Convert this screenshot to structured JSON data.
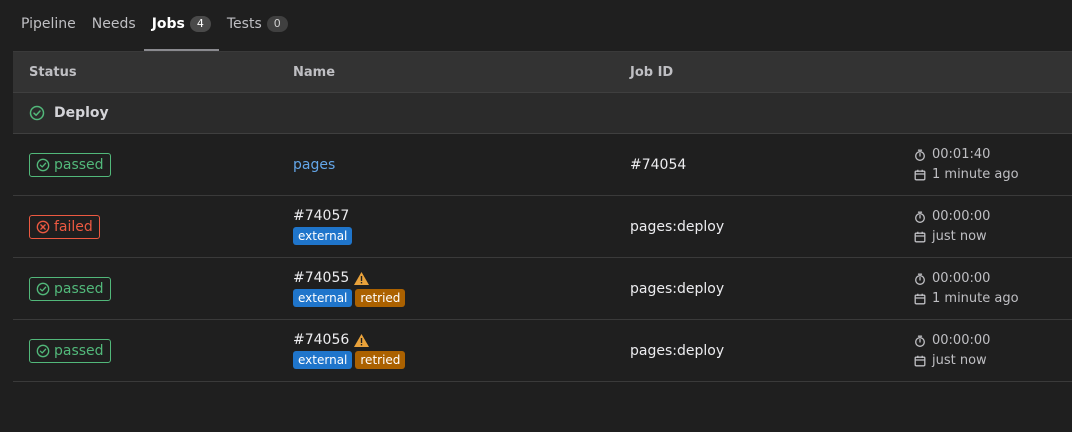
{
  "tabs": [
    {
      "label": "Pipeline"
    },
    {
      "label": "Needs"
    },
    {
      "label": "Jobs",
      "count": "4",
      "active": true
    },
    {
      "label": "Tests",
      "count": "0"
    }
  ],
  "table": {
    "headers": {
      "status": "Status",
      "name": "Name",
      "job_id": "Job ID"
    },
    "group": {
      "label": "Deploy",
      "icon": "status-success-icon"
    },
    "rows": [
      {
        "status": "passed",
        "name": "pages",
        "job_id": "#74054",
        "duration": "00:01:40",
        "finished": "1 minute ago"
      },
      {
        "status": "failed",
        "name": "#74057",
        "labels": [
          "external"
        ],
        "job_id": "pages:deploy",
        "duration": "00:00:00",
        "finished": "just now"
      },
      {
        "status": "passed",
        "name": "#74055",
        "warning": true,
        "labels": [
          "external",
          "retried"
        ],
        "job_id": "pages:deploy",
        "duration": "00:00:00",
        "finished": "1 minute ago"
      },
      {
        "status": "passed",
        "name": "#74056",
        "warning": true,
        "labels": [
          "external",
          "retried"
        ],
        "job_id": "pages:deploy",
        "duration": "00:00:00",
        "finished": "just now"
      }
    ]
  },
  "colors": {
    "success": "#52b87a",
    "failed": "#ec5941",
    "link": "#63a6e9",
    "external": "#1f75cb",
    "retried": "#ab6100",
    "warning": "#e9a23b"
  }
}
